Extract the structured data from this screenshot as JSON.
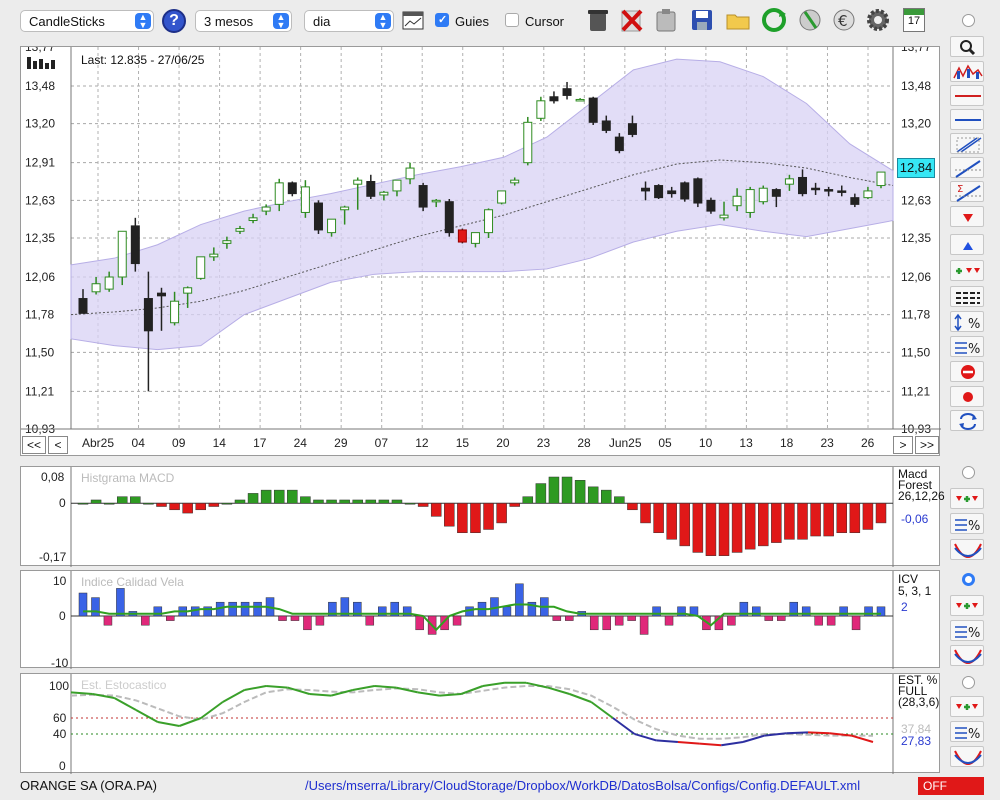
{
  "toolbar": {
    "chart_type": "CandleSticks",
    "period": "3 mesos",
    "interval": "dia",
    "guides_label": "Guies",
    "guides_checked": true,
    "cursor_label": "Cursor",
    "cursor_checked": false,
    "help_icon": "?",
    "calendar_day": "17"
  },
  "main_chart": {
    "info": "Last: 12.835 - 27/06/25",
    "last_price_badge": "12,84",
    "y_ticks": [
      "13,77",
      "13,48",
      "13,20",
      "12,91",
      "12,63",
      "12,35",
      "12,06",
      "11,78",
      "11,50",
      "11,21",
      "10,93"
    ],
    "x_ticks": [
      "Abr25",
      "04",
      "09",
      "14",
      "17",
      "24",
      "29",
      "07",
      "12",
      "15",
      "20",
      "23",
      "28",
      "Jun25",
      "05",
      "10",
      "13",
      "18",
      "23",
      "26"
    ],
    "nav_buttons": [
      "<<",
      "<",
      ">",
      ">>"
    ]
  },
  "macd_panel": {
    "title": "Histgrama MACD",
    "name_line1": "Macd",
    "name_line2": "Forest",
    "params": "26,12,26",
    "value": "-0,06",
    "y_ticks": [
      "0,08",
      "0",
      "-0,17"
    ]
  },
  "icv_panel": {
    "title": "Indice Calidad Vela",
    "name": "ICV",
    "params": "5, 3, 1",
    "value": "2",
    "y_ticks": [
      "10",
      "0",
      "-10"
    ]
  },
  "stoch_panel": {
    "title": "Est. Estocastico",
    "name_line1": "EST. %",
    "name_line2": "FULL",
    "params": "(28,3,6)",
    "value_gray": "37,84",
    "value_blue": "27,83",
    "y_ticks": [
      "100",
      "60",
      "40",
      "0"
    ]
  },
  "status": {
    "symbol": "ORANGE SA (ORA.PA)",
    "config_path": "/Users/mserra/Library/CloudStorage/Dropbox/WorkDB/DatosBolsa/Configs/Config.DEFAULT.xml",
    "off_label": "OFF"
  },
  "colors": {
    "up": "#2e8b20",
    "down": "#222222",
    "up_fill": "#ffffff",
    "bear_red": "#e01818",
    "icv_blue": "#3a63e6",
    "icv_pink": "#e0287a",
    "band_fill": "#d8d2f4",
    "accent": "#2f7bf5"
  },
  "chart_data": [
    {
      "type": "candlestick",
      "title": "",
      "ylim": [
        10.93,
        13.77
      ],
      "y_ticks": [
        13.48,
        13.2,
        12.91,
        12.63,
        12.35,
        12.06,
        11.78,
        11.5,
        11.21,
        10.93
      ],
      "candles": [
        {
          "o": 11.9,
          "h": 11.97,
          "c": 11.79,
          "l": 11.79
        },
        {
          "o": 11.95,
          "h": 12.06,
          "c": 12.01,
          "l": 11.93
        },
        {
          "o": 11.97,
          "h": 12.1,
          "c": 12.06,
          "l": 11.95
        },
        {
          "o": 12.06,
          "h": 12.3,
          "c": 12.4,
          "l": 12.0
        },
        {
          "o": 12.44,
          "h": 12.5,
          "c": 12.16,
          "l": 12.1
        },
        {
          "o": 11.9,
          "h": 12.1,
          "c": 11.66,
          "l": 11.21
        },
        {
          "o": 11.94,
          "h": 11.98,
          "c": 11.92,
          "l": 11.66
        },
        {
          "o": 11.72,
          "h": 11.95,
          "c": 11.88,
          "l": 11.7
        },
        {
          "o": 11.94,
          "h": 11.99,
          "c": 11.98,
          "l": 11.83
        },
        {
          "o": 12.05,
          "h": 12.2,
          "c": 12.21,
          "l": 12.04
        },
        {
          "o": 12.21,
          "h": 12.28,
          "c": 12.23,
          "l": 12.18
        },
        {
          "o": 12.31,
          "h": 12.36,
          "c": 12.33,
          "l": 12.27
        },
        {
          "o": 12.4,
          "h": 12.44,
          "c": 12.42,
          "l": 12.38
        },
        {
          "o": 12.48,
          "h": 12.53,
          "c": 12.5,
          "l": 12.46
        },
        {
          "o": 12.55,
          "h": 12.6,
          "c": 12.58,
          "l": 12.52
        },
        {
          "o": 12.6,
          "h": 12.79,
          "c": 12.76,
          "l": 12.55
        },
        {
          "o": 12.76,
          "h": 12.77,
          "c": 12.68,
          "l": 12.66
        },
        {
          "o": 12.54,
          "h": 12.78,
          "c": 12.73,
          "l": 12.5
        },
        {
          "o": 12.61,
          "h": 12.63,
          "c": 12.41,
          "l": 12.38
        },
        {
          "o": 12.39,
          "h": 12.45,
          "c": 12.49,
          "l": 12.36
        },
        {
          "o": 12.56,
          "h": 12.59,
          "c": 12.58,
          "l": 12.45
        },
        {
          "o": 12.75,
          "h": 12.8,
          "c": 12.78,
          "l": 12.56
        },
        {
          "o": 12.77,
          "h": 12.82,
          "c": 12.66,
          "l": 12.64
        },
        {
          "o": 12.67,
          "h": 12.7,
          "c": 12.69,
          "l": 12.63
        },
        {
          "o": 12.7,
          "h": 12.77,
          "c": 12.78,
          "l": 12.66
        },
        {
          "o": 12.79,
          "h": 12.91,
          "c": 12.87,
          "l": 12.75
        },
        {
          "o": 12.74,
          "h": 12.76,
          "c": 12.58,
          "l": 12.55
        },
        {
          "o": 12.62,
          "h": 12.64,
          "c": 12.63,
          "l": 12.58
        },
        {
          "o": 12.62,
          "h": 12.64,
          "c": 12.39,
          "l": 12.36
        },
        {
          "o": 12.41,
          "h": 12.42,
          "c": 12.32,
          "l": 12.31
        },
        {
          "o": 12.31,
          "h": 12.39,
          "c": 12.39,
          "l": 12.28
        },
        {
          "o": 12.39,
          "h": 12.57,
          "c": 12.56,
          "l": 12.35
        },
        {
          "o": 12.61,
          "h": 12.69,
          "c": 12.7,
          "l": 12.6
        },
        {
          "o": 12.76,
          "h": 12.8,
          "c": 12.78,
          "l": 12.74
        },
        {
          "o": 12.91,
          "h": 13.25,
          "c": 13.21,
          "l": 12.89
        },
        {
          "o": 13.24,
          "h": 13.4,
          "c": 13.37,
          "l": 13.22
        },
        {
          "o": 13.4,
          "h": 13.44,
          "c": 13.37,
          "l": 13.35
        },
        {
          "o": 13.46,
          "h": 13.51,
          "c": 13.41,
          "l": 13.38
        },
        {
          "o": 13.38,
          "h": 13.39,
          "c": 13.38,
          "l": 13.37
        },
        {
          "o": 13.39,
          "h": 13.4,
          "c": 13.21,
          "l": 13.19
        },
        {
          "o": 13.22,
          "h": 13.26,
          "c": 13.15,
          "l": 13.13
        },
        {
          "o": 13.1,
          "h": 13.13,
          "c": 13.0,
          "l": 12.98
        },
        {
          "o": 13.2,
          "h": 13.26,
          "c": 13.12,
          "l": 13.1
        },
        {
          "o": 12.72,
          "h": 12.77,
          "c": 12.7,
          "l": 12.63
        },
        {
          "o": 12.74,
          "h": 12.75,
          "c": 12.65,
          "l": 12.64
        },
        {
          "o": 12.7,
          "h": 12.73,
          "c": 12.68,
          "l": 12.65
        },
        {
          "o": 12.76,
          "h": 12.77,
          "c": 12.64,
          "l": 12.62
        },
        {
          "o": 12.79,
          "h": 12.8,
          "c": 12.61,
          "l": 12.58
        },
        {
          "o": 12.63,
          "h": 12.65,
          "c": 12.55,
          "l": 12.53
        },
        {
          "o": 12.5,
          "h": 12.62,
          "c": 12.52,
          "l": 12.48
        },
        {
          "o": 12.59,
          "h": 12.72,
          "c": 12.66,
          "l": 12.55
        },
        {
          "o": 12.54,
          "h": 12.73,
          "c": 12.71,
          "l": 12.5
        },
        {
          "o": 12.62,
          "h": 12.74,
          "c": 12.72,
          "l": 12.6
        },
        {
          "o": 12.71,
          "h": 12.72,
          "c": 12.66,
          "l": 12.58
        },
        {
          "o": 12.75,
          "h": 12.82,
          "c": 12.79,
          "l": 12.7
        },
        {
          "o": 12.8,
          "h": 12.86,
          "c": 12.68,
          "l": 12.66
        },
        {
          "o": 12.72,
          "h": 12.76,
          "c": 12.71,
          "l": 12.67
        },
        {
          "o": 12.71,
          "h": 12.73,
          "c": 12.7,
          "l": 12.66
        },
        {
          "o": 12.7,
          "h": 12.74,
          "c": 12.69,
          "l": 12.66
        },
        {
          "o": 12.65,
          "h": 12.68,
          "c": 12.6,
          "l": 12.58
        },
        {
          "o": 12.65,
          "h": 12.73,
          "c": 12.7,
          "l": 12.64
        },
        {
          "o": 12.74,
          "h": 12.84,
          "c": 12.84,
          "l": 12.72
        }
      ],
      "band_upper": [
        12.15,
        12.2,
        12.3,
        12.45,
        12.55,
        12.62,
        12.68,
        12.75,
        12.82,
        12.88,
        12.95,
        13.1,
        13.35,
        13.6,
        13.68,
        13.66,
        13.55,
        13.35,
        13.05,
        12.85
      ],
      "band_lower": [
        11.6,
        11.55,
        11.52,
        11.55,
        11.78,
        11.9,
        12.02,
        12.08,
        12.1,
        12.1,
        12.1,
        12.12,
        12.2,
        12.32,
        12.4,
        12.45,
        12.4,
        12.36,
        12.42,
        12.48
      ],
      "ma": [
        11.78,
        11.8,
        11.83,
        11.88,
        11.96,
        12.06,
        12.16,
        12.26,
        12.36,
        12.44,
        12.52,
        12.62,
        12.72,
        12.82,
        12.9,
        12.93,
        12.91,
        12.87,
        12.8,
        12.74
      ]
    },
    {
      "type": "bar",
      "title": "Histgrama MACD",
      "ylim": [
        -0.17,
        0.08
      ],
      "values": [
        0.0,
        0.01,
        0.0,
        0.02,
        0.02,
        0.0,
        -0.01,
        -0.02,
        -0.03,
        -0.02,
        -0.01,
        0.0,
        0.01,
        0.03,
        0.04,
        0.04,
        0.04,
        0.02,
        0.01,
        0.01,
        0.01,
        0.01,
        0.01,
        0.01,
        0.01,
        0.0,
        -0.01,
        -0.04,
        -0.07,
        -0.09,
        -0.09,
        -0.08,
        -0.06,
        -0.01,
        0.02,
        0.06,
        0.08,
        0.08,
        0.07,
        0.05,
        0.04,
        0.02,
        -0.02,
        -0.06,
        -0.09,
        -0.11,
        -0.13,
        -0.15,
        -0.16,
        -0.16,
        -0.15,
        -0.14,
        -0.13,
        -0.12,
        -0.11,
        -0.11,
        -0.1,
        -0.1,
        -0.09,
        -0.09,
        -0.08,
        -0.06
      ]
    },
    {
      "type": "bar",
      "title": "Indice Calidad Vela",
      "ylim": [
        -10,
        10
      ],
      "values": [
        5,
        4,
        -2,
        6,
        1,
        -2,
        2,
        -1,
        2,
        2,
        2,
        3,
        3,
        3,
        3,
        4,
        -1,
        -1,
        -3,
        -2,
        3,
        4,
        3,
        -2,
        2,
        3,
        2,
        -3,
        -4,
        -3,
        -2,
        2,
        3,
        4,
        2,
        7,
        3,
        4,
        -1,
        -1,
        1,
        -3,
        -3,
        -2,
        -1,
        -4,
        2,
        -2,
        2,
        2,
        -3,
        -3,
        -2,
        3,
        2,
        -1,
        -1,
        3,
        2,
        -2,
        -2,
        2,
        -3,
        2,
        2
      ],
      "line": [
        1,
        1,
        0.5,
        0.5,
        0.5,
        0.5,
        0.5,
        1,
        1,
        1.5,
        1.5,
        2,
        2,
        2,
        2,
        1.5,
        0.5,
        0.5,
        0.5,
        0.5,
        0.5,
        0.5,
        0.5,
        0.5,
        0.5,
        0.5,
        0,
        -3,
        0,
        1,
        1.5,
        1.5,
        2,
        2.5,
        2.5,
        2,
        2,
        1,
        0.5,
        0.5,
        0.5,
        0.5,
        0.5,
        0.5,
        0.5,
        0.5,
        0.5,
        0,
        -2,
        0.5,
        0.5,
        0.5,
        0.5,
        0.5,
        0.5,
        0.5,
        0.5,
        0.5,
        0.5,
        0.5,
        0.5,
        0.5
      ]
    },
    {
      "type": "line",
      "title": "Est. Estocastico",
      "ylim": [
        0,
        105
      ],
      "series": [
        {
          "name": "K",
          "color": "#3aa02a",
          "values": [
            92,
            90,
            85,
            70,
            55,
            50,
            60,
            80,
            95,
            100,
            98,
            90,
            88,
            95,
            100,
            98,
            92,
            88,
            90,
            100,
            104,
            104,
            98,
            90,
            80,
            60,
            40,
            32,
            30,
            28,
            26,
            30,
            38,
            41,
            42,
            41,
            38,
            30
          ]
        },
        {
          "name": "D",
          "color": "#bbbbbb",
          "values": [
            88,
            89,
            88,
            82,
            72,
            62,
            58,
            66,
            80,
            92,
            96,
            95,
            93,
            92,
            95,
            97,
            96,
            92,
            90,
            94,
            98,
            100,
            100,
            96,
            88,
            74,
            58,
            46,
            38,
            34,
            34,
            36,
            40,
            40,
            39,
            38,
            38,
            37.84
          ]
        }
      ]
    }
  ]
}
